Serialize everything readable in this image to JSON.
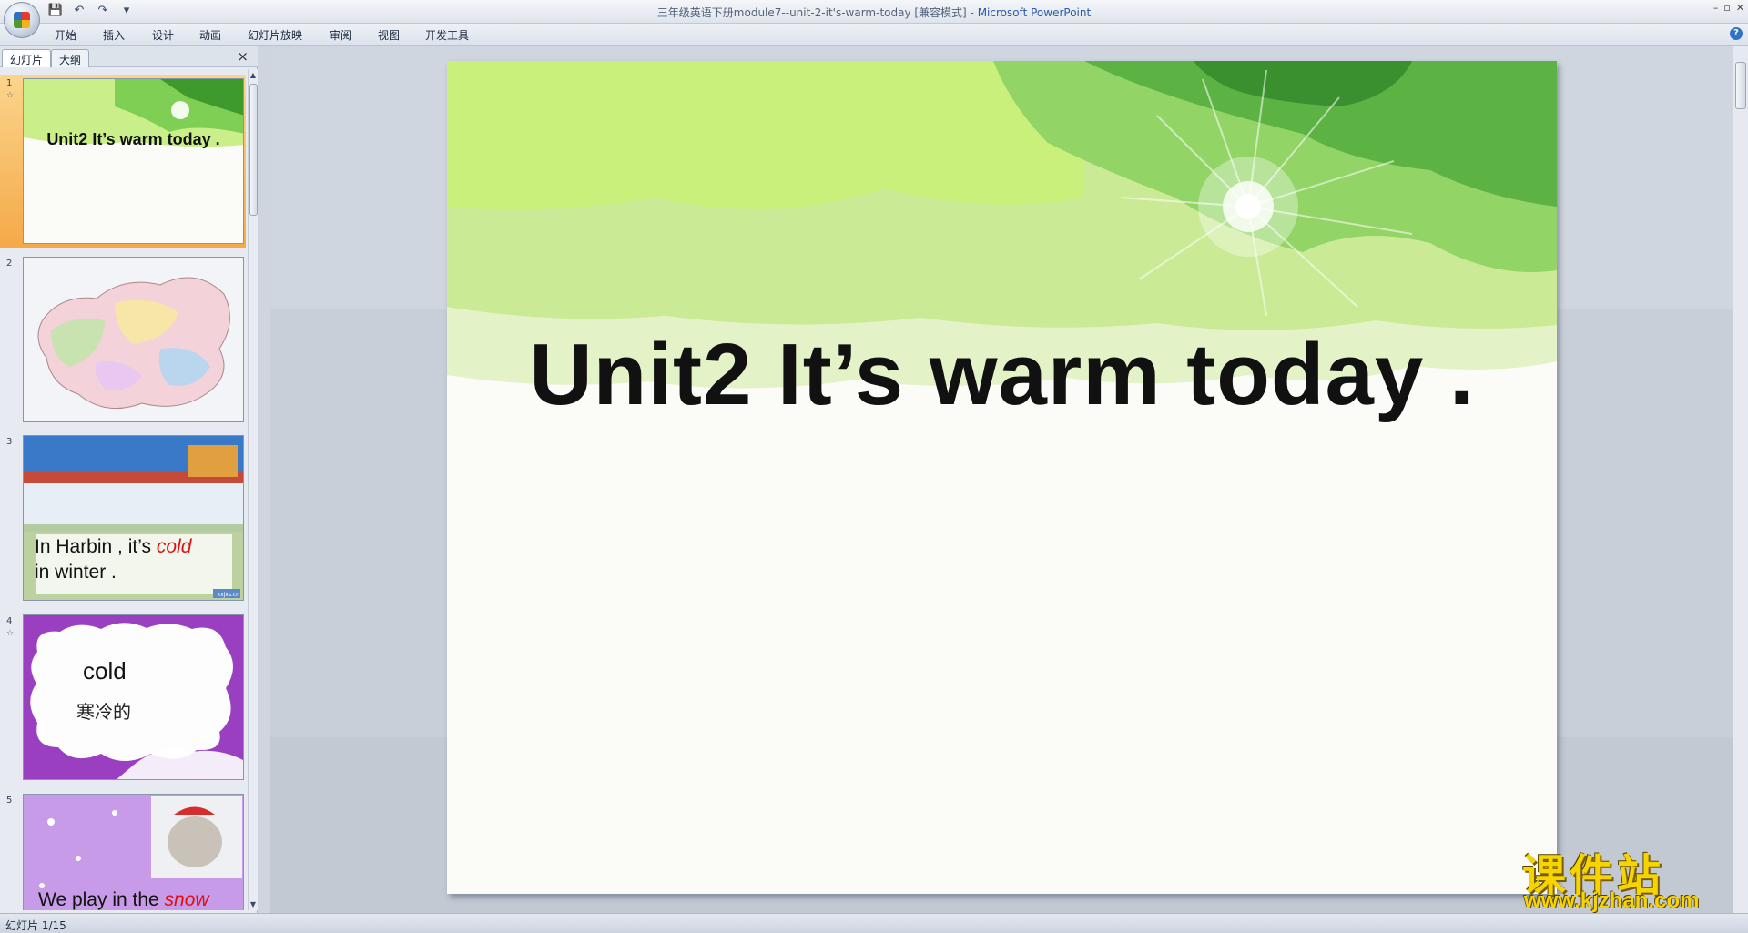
{
  "window": {
    "title": "三年级英语下册module7--unit-2-it's-warm-today [兼容模式] - ",
    "app_name": "Microsoft PowerPoint"
  },
  "qat": {
    "save": "💾",
    "undo": "↶",
    "redo": "↷",
    "more": "▾"
  },
  "ribbon": {
    "tabs": [
      "开始",
      "插入",
      "设计",
      "动画",
      "幻灯片放映",
      "审阅",
      "视图",
      "开发工具"
    ]
  },
  "panel": {
    "tabs": [
      "幻灯片",
      "大纲"
    ],
    "close": "×",
    "slides": [
      {
        "num": "1",
        "star": "☆",
        "title": "Unit2 It’s warm today ."
      },
      {
        "num": "2"
      },
      {
        "num": "3",
        "line1a": "In Harbin , it’s ",
        "line1b": "cold",
        "line2": "in winter .",
        "badge": "xxjxs.cn"
      },
      {
        "num": "4",
        "star": "☆",
        "word": "cold",
        "meaning": "寒冷的"
      },
      {
        "num": "5",
        "text_a": "We play in the ",
        "text_b": "snow"
      }
    ]
  },
  "slide": {
    "title": "Unit2 It’s warm today ."
  },
  "status": {
    "text": "幻灯片 1/15"
  },
  "watermark": {
    "cn": "课件站",
    "url": "www.kjzhan.com"
  },
  "colors": {
    "accent_red": "#e01010",
    "selection": "#f5a948",
    "slide_green": "#9fdc5b"
  }
}
